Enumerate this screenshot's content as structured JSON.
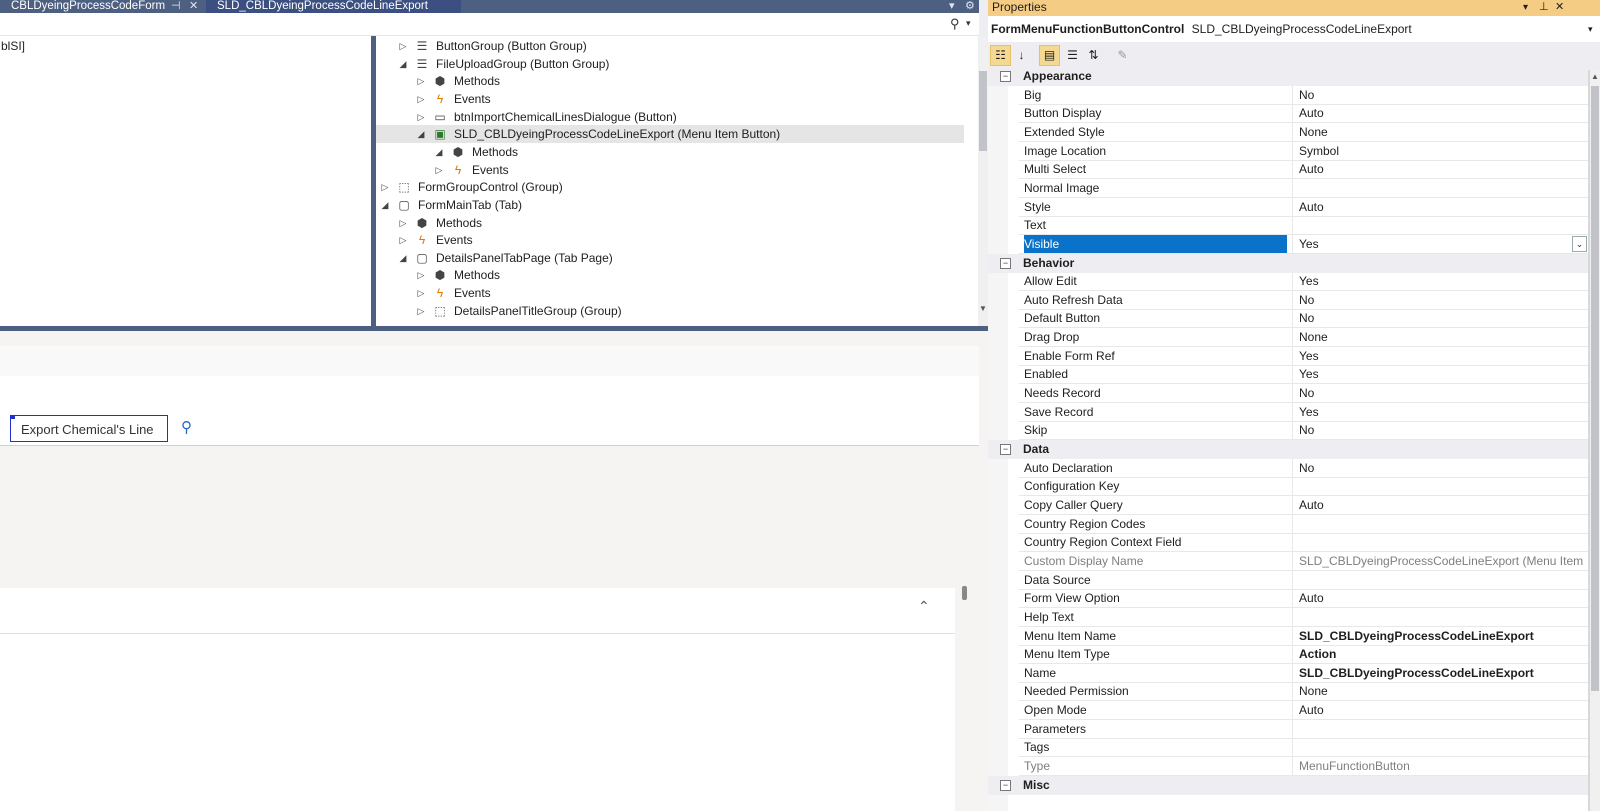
{
  "tabs": [
    {
      "label": "CBLDyeingProcessCodeForm"
    },
    {
      "label": "SLD_CBLDyeingProcessCodeLineExport"
    }
  ],
  "left_pane_text": "blSI]",
  "tree": [
    {
      "label": "ButtonGroup (Button Group)",
      "icon": "button-group-icon"
    },
    {
      "label": "FileUploadGroup (Button Group)",
      "icon": "button-group-icon"
    },
    {
      "label": "Methods",
      "icon": "methods-icon"
    },
    {
      "label": "Events",
      "icon": "events-icon"
    },
    {
      "label": "btnImportChemicalLinesDialogue (Button)",
      "icon": "button-icon"
    },
    {
      "label": "SLD_CBLDyeingProcessCodeLineExport (Menu Item Button)",
      "icon": "menu-item-button-icon"
    },
    {
      "label": "Methods",
      "icon": "methods-icon"
    },
    {
      "label": "Events",
      "icon": "events-icon"
    },
    {
      "label": "FormGroupControl (Group)",
      "icon": "group-icon"
    },
    {
      "label": "FormMainTab (Tab)",
      "icon": "tab-icon"
    },
    {
      "label": "Methods",
      "icon": "methods-icon"
    },
    {
      "label": "Events",
      "icon": "events-icon"
    },
    {
      "label": "DetailsPanelTabPage (Tab Page)",
      "icon": "tab-page-icon"
    },
    {
      "label": "Methods",
      "icon": "methods-icon"
    },
    {
      "label": "Events",
      "icon": "events-icon"
    },
    {
      "label": "DetailsPanelTitleGroup (Group)",
      "icon": "group-icon"
    }
  ],
  "designer": {
    "export_button_label": "Export Chemical's Line"
  },
  "properties": {
    "title": "Properties",
    "object_type": "FormMenuFunctionButtonControl",
    "object_name": "SLD_CBLDyeingProcessCodeLineExport",
    "categories": [
      {
        "name": "Appearance",
        "rows": [
          {
            "name": "Big",
            "value": "No"
          },
          {
            "name": "Button Display",
            "value": "Auto"
          },
          {
            "name": "Extended Style",
            "value": "None"
          },
          {
            "name": "Image Location",
            "value": "Symbol"
          },
          {
            "name": "Multi Select",
            "value": "Auto"
          },
          {
            "name": "Normal Image",
            "value": ""
          },
          {
            "name": "Style",
            "value": "Auto"
          },
          {
            "name": "Text",
            "value": ""
          },
          {
            "name": "Visible",
            "value": "Yes"
          }
        ]
      },
      {
        "name": "Behavior",
        "rows": [
          {
            "name": "Allow Edit",
            "value": "Yes"
          },
          {
            "name": "Auto Refresh Data",
            "value": "No"
          },
          {
            "name": "Default Button",
            "value": "No"
          },
          {
            "name": "Drag Drop",
            "value": "None"
          },
          {
            "name": "Enable Form Ref",
            "value": "Yes"
          },
          {
            "name": "Enabled",
            "value": "Yes"
          },
          {
            "name": "Needs Record",
            "value": "No"
          },
          {
            "name": "Save Record",
            "value": "Yes"
          },
          {
            "name": "Skip",
            "value": "No"
          }
        ]
      },
      {
        "name": "Data",
        "rows": [
          {
            "name": "Auto Declaration",
            "value": "No"
          },
          {
            "name": "Configuration Key",
            "value": ""
          },
          {
            "name": "Copy Caller Query",
            "value": "Auto"
          },
          {
            "name": "Country Region Codes",
            "value": ""
          },
          {
            "name": "Country Region Context Field",
            "value": ""
          },
          {
            "name": "Custom Display Name",
            "value": "SLD_CBLDyeingProcessCodeLineExport (Menu Item"
          },
          {
            "name": "Data Source",
            "value": ""
          },
          {
            "name": "Form View Option",
            "value": "Auto"
          },
          {
            "name": "Help Text",
            "value": ""
          },
          {
            "name": "Menu Item Name",
            "value": "SLD_CBLDyeingProcessCodeLineExport"
          },
          {
            "name": "Menu Item Type",
            "value": "Action"
          },
          {
            "name": "Name",
            "value": "SLD_CBLDyeingProcessCodeLineExport"
          },
          {
            "name": "Needed Permission",
            "value": "None"
          },
          {
            "name": "Open Mode",
            "value": "Auto"
          },
          {
            "name": "Parameters",
            "value": ""
          },
          {
            "name": "Tags",
            "value": ""
          },
          {
            "name": "Type",
            "value": "MenuFunctionButton"
          }
        ]
      },
      {
        "name": "Misc",
        "rows": []
      }
    ]
  },
  "colors": {
    "tab_strip": "#4d6082",
    "active_tab": "#3b4f81",
    "properties_title": "#f5cc84",
    "selection": "#0a72c9"
  }
}
